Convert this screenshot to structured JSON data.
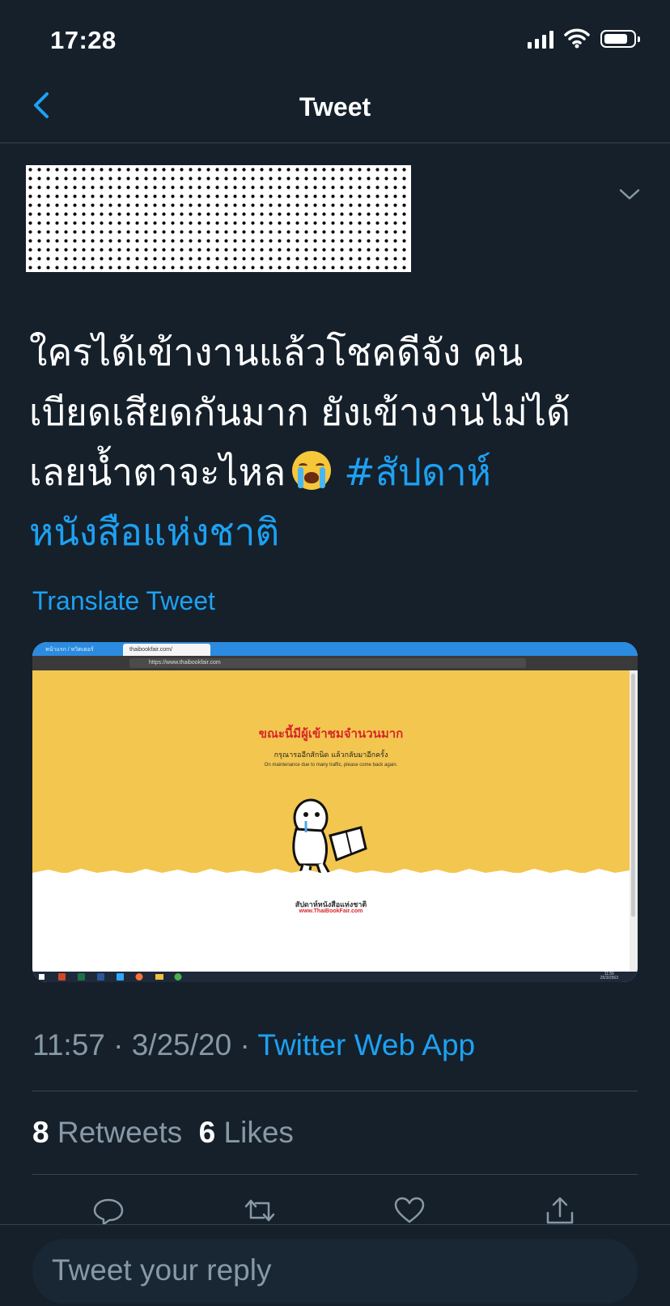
{
  "status_bar": {
    "time": "17:28"
  },
  "nav": {
    "title": "Tweet",
    "back_icon": "chevron-left-icon"
  },
  "tweet": {
    "text_lines": [
      "ใครได้เข้างานแล้วโชคดีจัง คน",
      "เบียดเสียดกันมาก ยังเข้างานไม่ได้",
      "เลยน้ำตาจะไหล"
    ],
    "emoji": "loudly-crying-face-emoji",
    "hashtag_line1": "#สัปดาห์",
    "hashtag_line2": "หนังสือแห่งชาติ",
    "translate_label": "Translate Tweet",
    "timestamp": "11:57 · 3/25/20 · ",
    "source": "Twitter Web App",
    "retweets_count": "8",
    "retweets_label": "Retweets",
    "likes_count": "6",
    "likes_label": "Likes"
  },
  "media": {
    "tab1": "หน้าแรก / ทวิตเตอร์",
    "tab2": "thaibookfair.com/",
    "url": "https://www.thaibookfair.com",
    "headline": "ขณะนี้มีผู้เข้าชมจำนวนมาก",
    "subline": "กรุณารออีกสักนิด แล้วกลับมาอีกครั้ง",
    "note": "On maintenance due to many traffic, please come back again.",
    "logo_text": "สัปดาห์หนังสือแห่งชาติ",
    "logo_url": "www.ThaiBookFair.com",
    "clock_time": "11:56",
    "clock_date": "25/3/2563",
    "lang": "ENG"
  },
  "reply": {
    "placeholder": "Tweet your reply"
  },
  "colors": {
    "background": "#15202b",
    "accent": "#1da1f2",
    "muted": "#8899a6",
    "divider": "#38444d"
  }
}
